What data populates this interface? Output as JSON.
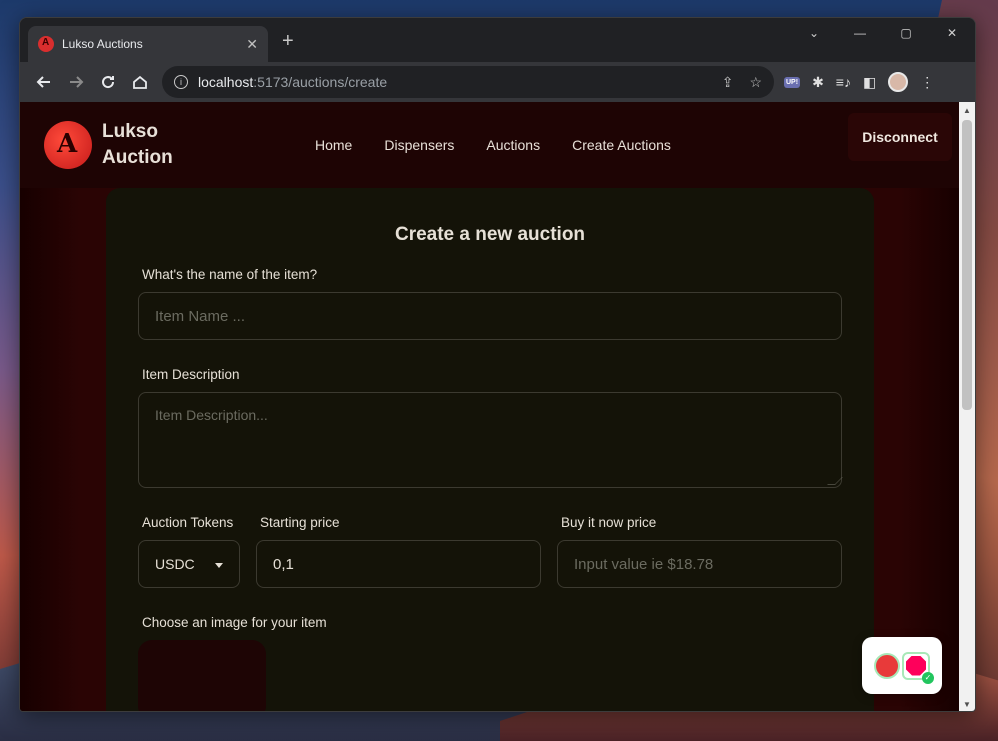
{
  "browser": {
    "tab_title": "Lukso Auctions",
    "tab_close": "✕",
    "new_tab": "+",
    "url_host": "localhost",
    "url_rest": ":5173/auctions/create",
    "controls": {
      "minimize": "—",
      "maximize": "▢",
      "close": "✕",
      "tab_search": "⌄"
    }
  },
  "site": {
    "logo_line1": "Lukso",
    "logo_line2": "Auction",
    "nav": [
      "Home",
      "Dispensers",
      "Auctions",
      "Create Auctions"
    ],
    "disconnect_label": "Disconnect"
  },
  "form": {
    "title": "Create a new auction",
    "name_label": "What's the name of the item?",
    "name_placeholder": "Item Name ...",
    "description_label": "Item Description",
    "description_placeholder": "Item Description...",
    "tokens_label": "Auction Tokens",
    "tokens_value": "USDC",
    "starting_price_label": "Starting price",
    "starting_price_value": "0,1",
    "buy_now_label": "Buy it now price",
    "buy_now_placeholder": "Input value ie $18.78",
    "image_label": "Choose an image for your item"
  },
  "extension_icons": [
    "up-icon",
    "puzzle-icon",
    "media-queue-icon",
    "side-panel-icon",
    "profile-avatar",
    "menu-icon"
  ]
}
